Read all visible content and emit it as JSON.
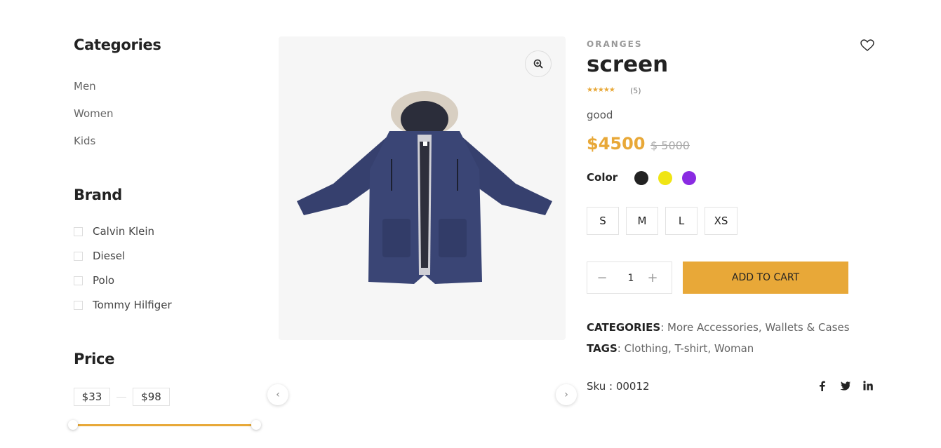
{
  "sidebar": {
    "categories_heading": "Categories",
    "categories": [
      "Men",
      "Women",
      "Kids"
    ],
    "brand_heading": "Brand",
    "brands": [
      "Calvin Klein",
      "Diesel",
      "Polo",
      "Tommy Hilfiger"
    ],
    "price_heading": "Price",
    "price_min": "$33",
    "price_max": "$98"
  },
  "product": {
    "brand": "ORANGES",
    "title": "screen",
    "stars": "★★★★★",
    "review_count": "(5)",
    "short_desc": "good",
    "price_now": "$4500",
    "price_old": "$ 5000",
    "color_label": "Color",
    "colors": [
      "#222222",
      "#f0e514",
      "#8a2be2"
    ],
    "sizes": [
      "S",
      "M",
      "L",
      "XS"
    ],
    "quantity": "1",
    "qty_minus": "−",
    "qty_plus": "+",
    "add_to_cart": "ADD TO CART",
    "categories_label": "CATEGORIES",
    "categories_sep": ": ",
    "categories_values": [
      "More Accessories",
      "Wallets & Cases"
    ],
    "tags_label": "TAGS",
    "tags_values": [
      "Clothing",
      "T-shirt",
      "Woman"
    ],
    "sku_text": "Sku : 00012",
    "social": [
      "facebook-icon",
      "twitter-icon",
      "linkedin-icon"
    ]
  },
  "gallery": {
    "prev": "‹",
    "next": "›"
  }
}
